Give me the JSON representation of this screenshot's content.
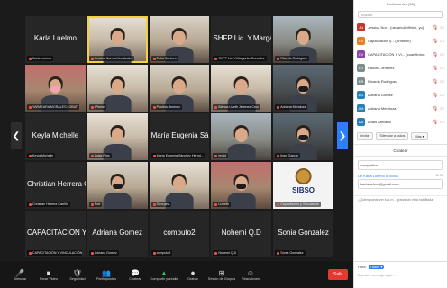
{
  "tiles": [
    {
      "type": "name",
      "display": "Karla Luelmo",
      "tag": "Karla Luelmo"
    },
    {
      "type": "cam",
      "variant": "c4",
      "tag": "Jessica Norma Hernández",
      "active": true,
      "mask": ""
    },
    {
      "type": "cam",
      "variant": "c2",
      "tag": "Erika Cantero",
      "mask": ""
    },
    {
      "type": "name",
      "display": "SHFP Lic. Y.Margari...",
      "tag": "SHFP Lic. Y.Margarita Gonzalez"
    },
    {
      "type": "cam",
      "variant": "c3",
      "tag": "Ricardo Rodriguez",
      "mask": ""
    },
    {
      "type": "cam",
      "variant": "c6",
      "tag": "YARAZARA MORALES LOBAT",
      "mask": "pink"
    },
    {
      "type": "cam",
      "variant": "c4",
      "tag": "iPhone",
      "mask": ""
    },
    {
      "type": "cam",
      "variant": "c2",
      "tag": "Paulina Jimenez",
      "mask": ""
    },
    {
      "type": "cam",
      "variant": "c4",
      "tag": "Blanca Lizeth Jimenez Cruz",
      "mask": ""
    },
    {
      "type": "cam",
      "variant": "c5",
      "tag": "Adriana Mendoza",
      "mask": "black"
    },
    {
      "type": "name",
      "display": "Keyla Michelle",
      "tag": "Keyla Michelle"
    },
    {
      "type": "cam",
      "variant": "c4",
      "tag": "Luisa Rios",
      "mask": ""
    },
    {
      "type": "name",
      "display": "María Eugenia Sánc...",
      "tag": "María Eugenia Sánchez Hernd..."
    },
    {
      "type": "cam",
      "variant": "c3",
      "tag": "jerald",
      "mask": ""
    },
    {
      "type": "cam",
      "variant": "c5",
      "tag": "Ilyan García",
      "mask": "black"
    },
    {
      "type": "name",
      "display": "Christian Herrera C...",
      "tag": "Christian Herrera Carrillo"
    },
    {
      "type": "cam",
      "variant": "c2",
      "tag": "Noe",
      "mask": "black"
    },
    {
      "type": "cam",
      "variant": "c4",
      "tag": "Georgina",
      "mask": ""
    },
    {
      "type": "cam",
      "variant": "c6",
      "tag": "Lizbeth",
      "mask": "black"
    },
    {
      "type": "sibso",
      "logo": "SIBSO",
      "tag": "Capacitación y Vinculación"
    },
    {
      "type": "name",
      "display": "CAPACITACIÓN Y V...",
      "tag": "CAPACITACIÓN Y VINCULACIÓN"
    },
    {
      "type": "name",
      "display": "Adriana Gomez",
      "tag": "Adriana Gomez"
    },
    {
      "type": "name",
      "display": "computo2",
      "tag": "computo2"
    },
    {
      "type": "name",
      "display": "Nohemi Q.D",
      "tag": "Nohemi Q.D"
    },
    {
      "type": "name",
      "display": "Sonia Gonzalez",
      "tag": "Sonia Gonzalez"
    }
  ],
  "toolbar": {
    "items": [
      {
        "icon": "🎤",
        "label": "Silenciar",
        "name": "mute"
      },
      {
        "icon": "■",
        "label": "Parar Video",
        "name": "stop-video"
      },
      {
        "icon": "🛡",
        "label": "Seguridad",
        "name": "security"
      },
      {
        "icon": "👥",
        "label": "Participantes",
        "name": "participants"
      },
      {
        "icon": "💬",
        "label": "Chatear",
        "name": "chat"
      },
      {
        "icon": "▲",
        "label": "Compartir pantalla",
        "name": "share-screen",
        "green": true
      },
      {
        "icon": "⏺",
        "label": "Grabar",
        "name": "record"
      },
      {
        "icon": "⊞",
        "label": "Sesión de Grupos",
        "name": "breakout"
      },
      {
        "icon": "☺",
        "label": "Reacciones",
        "name": "reactions"
      }
    ],
    "leave": "Salir"
  },
  "panel": {
    "title": "Participantes (56)",
    "search_placeholder": "Buscar",
    "participants": [
      {
        "initials": "JN",
        "name": "Jessica Nor... (usuarioAnfitrión, yo)",
        "color": "#c0392b"
      },
      {
        "initials": "CV",
        "name": "Capacitación y... (Anfitrión)",
        "color": "#e67e22"
      },
      {
        "initials": "CV",
        "name": "CAPACITACIÓN Y VI... (coanfitrión)",
        "color": "#8e44ad"
      },
      {
        "initials": "PJ",
        "name": "Paulina Jimenez",
        "color": "#7f8c8d"
      },
      {
        "initials": "RR",
        "name": "Ricardo Rodriguez",
        "color": "#7f8c8d"
      },
      {
        "initials": "AG",
        "name": "Adriana Gomez",
        "color": "#2980b9"
      },
      {
        "initials": "AM",
        "name": "Adriana Mendoza",
        "color": "#2980b9"
      },
      {
        "initials": "AA",
        "name": "Anahi Arellano",
        "color": "#2980b9"
      }
    ],
    "buttons": [
      "Invitar",
      "Silenciar a todos",
      "Más ▾"
    ],
    "chat_title": "Chatear",
    "messages": [
      {
        "from": "",
        "to": "",
        "text": "compartira",
        "time": ""
      },
      {
        "from": "De Karla Luelmo",
        "to": "a Todos",
        "text": "karlaluelmo@gmail.com",
        "time": "12:35"
      }
    ],
    "notice": "¿Quién puede ver sus m... grabación está habilitada",
    "compose_to_label": "Para:",
    "compose_to": "Todos ▾",
    "compose_placeholder": "Escribir mensaje aquí..."
  }
}
